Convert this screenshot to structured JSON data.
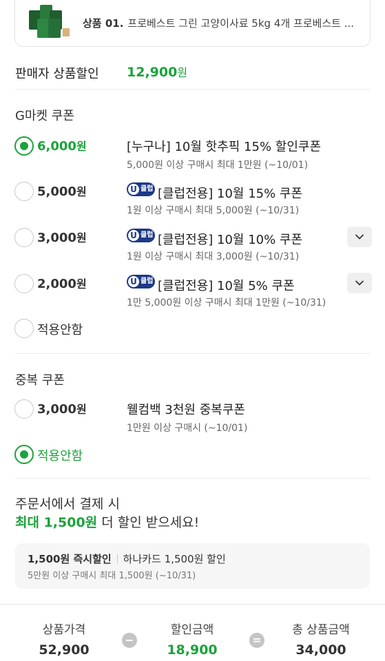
{
  "product": {
    "label": "상품 01.",
    "name": "프로베스트 그린 고양이사료 5kg 4개 프로베스트 ..."
  },
  "seller_discount": {
    "label": "판매자 상품할인",
    "amount": "12,900",
    "unit": "원"
  },
  "gmarket_coupons": {
    "title": "G마켓 쿠폰",
    "items": [
      {
        "amount": "6,000",
        "unit": "원",
        "selected": true,
        "club": false,
        "title": "[누구나] 10월 핫추픽 15% 할인쿠폰",
        "sub": "5,000원 이상 구매시 최대 1만원 (~10/01)"
      },
      {
        "amount": "5,000",
        "unit": "원",
        "selected": false,
        "club": true,
        "title": "[클럽전용] 10월 15% 쿠폰",
        "sub": "1원 이상 구매시 최대 5,000원 (~10/31)"
      },
      {
        "amount": "3,000",
        "unit": "원",
        "selected": false,
        "club": true,
        "title": "[클럽전용] 10월 10% 쿠폰",
        "sub": "1원 이상 구매시 최대 3,000원 (~10/31)"
      },
      {
        "amount": "2,000",
        "unit": "원",
        "selected": false,
        "club": true,
        "title": "[클럽전용] 10월 5% 쿠폰",
        "sub": "1만 5,000원 이상 구매시 최대 1만원 (~10/31)"
      }
    ],
    "none_label": "적용안함"
  },
  "badge": {
    "letter": "U",
    "text": "클럽"
  },
  "dup_coupons": {
    "title": "중복 쿠폰",
    "items": [
      {
        "amount": "3,000",
        "unit": "원",
        "title": "웰컴백 3천원 중복쿠폰",
        "sub": "1만원 이상 구매시 (~10/01)"
      }
    ],
    "none_label": "적용안함"
  },
  "promo": {
    "line1": "주문서에서 결제 시",
    "highlight": "최대 1,500원",
    "line2_rest": " 더 할인 받으세요!",
    "card_bold": "1,500원 즉시할인",
    "card_text": "하나카드 1,500원 할인",
    "card_sub": "5만원 이상 구매시 최대 1,500원 (~10/31)"
  },
  "summary": {
    "price_label": "상품가격",
    "price": "52,900",
    "discount_label": "할인금액",
    "discount": "18,900",
    "total_label": "총 상품금액",
    "total": "34,000",
    "minus": "−",
    "equals": "="
  },
  "colors": {
    "accent": "#1ba33b",
    "club_badge": "#1d3a86"
  }
}
